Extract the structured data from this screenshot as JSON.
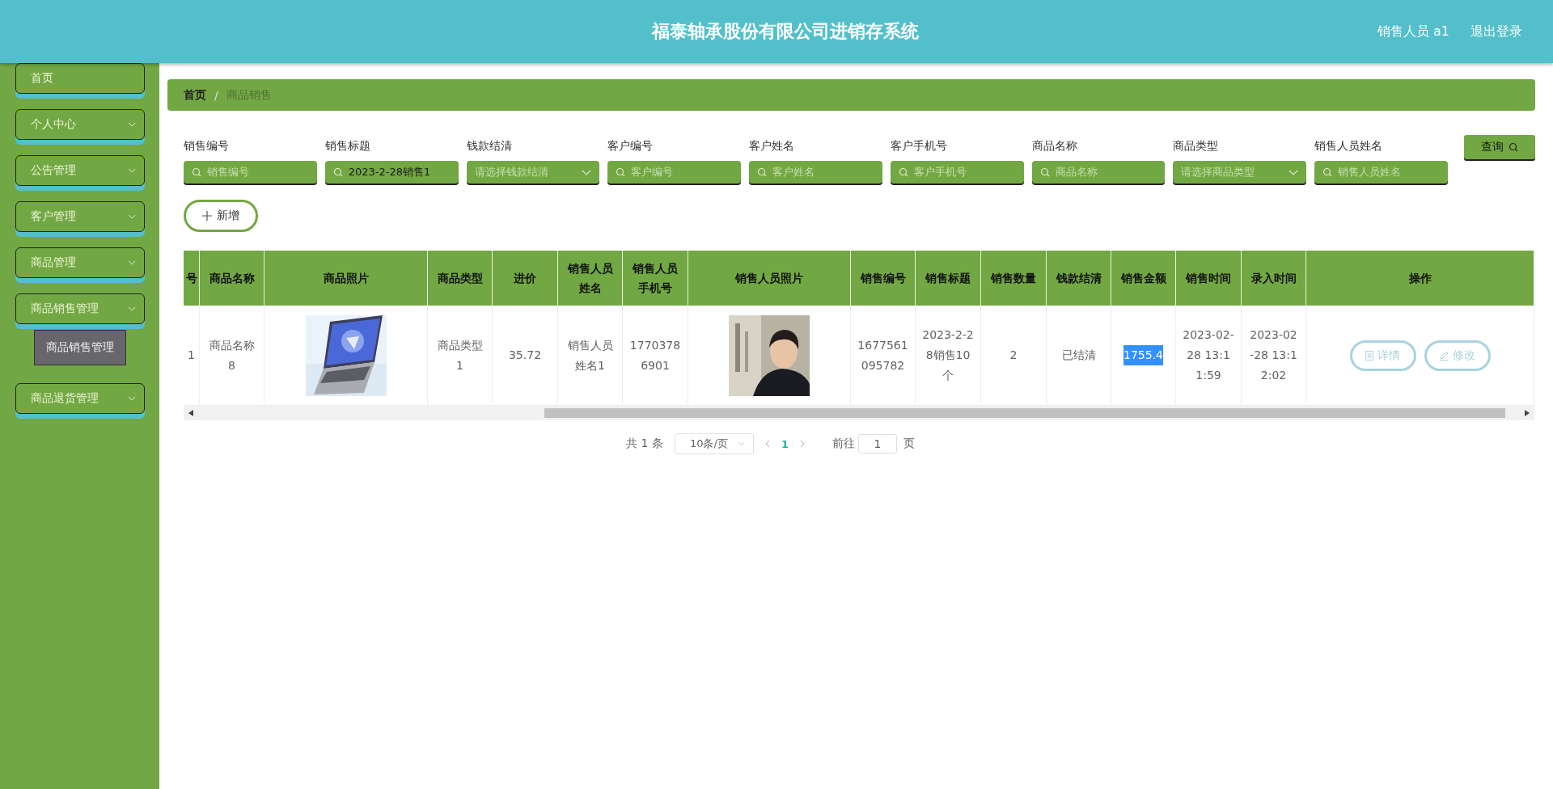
{
  "header": {
    "title": "福泰轴承股份有限公司进销存系统",
    "user": "销售人员 a1",
    "logout": "退出登录"
  },
  "sidebar": {
    "items": [
      {
        "label": "首页",
        "expandable": false
      },
      {
        "label": "个人中心",
        "expandable": true
      },
      {
        "label": "公告管理",
        "expandable": true
      },
      {
        "label": "客户管理",
        "expandable": true
      },
      {
        "label": "商品管理",
        "expandable": true
      },
      {
        "label": "商品销售管理",
        "expandable": true,
        "children": [
          {
            "label": "商品销售管理"
          }
        ]
      },
      {
        "label": "商品退货管理",
        "expandable": true
      }
    ]
  },
  "breadcrumb": [
    {
      "label": "首页",
      "current": false
    },
    {
      "label": "商品销售",
      "current": true
    }
  ],
  "breadcrumb_separator": "/",
  "filters": [
    {
      "label": "销售编号",
      "kind": "input",
      "placeholder": "销售编号"
    },
    {
      "label": "销售标题",
      "kind": "input",
      "value": "2023-2-28销售1"
    },
    {
      "label": "钱款结清",
      "kind": "select",
      "placeholder": "请选择钱款结清"
    },
    {
      "label": "客户编号",
      "kind": "input",
      "placeholder": "客户编号"
    },
    {
      "label": "客户姓名",
      "kind": "input",
      "placeholder": "客户姓名"
    },
    {
      "label": "客户手机号",
      "kind": "input",
      "placeholder": "客户手机号"
    },
    {
      "label": "商品名称",
      "kind": "input",
      "placeholder": "商品名称"
    },
    {
      "label": "商品类型",
      "kind": "select",
      "placeholder": "请选择商品类型"
    },
    {
      "label": "销售人员姓名",
      "kind": "input",
      "placeholder": "销售人员姓名"
    }
  ],
  "query_button": "查询",
  "add_button": "新增",
  "table": {
    "columns": [
      "号",
      "商品名称",
      "商品照片",
      "商品类型",
      "进价",
      "销售人员姓名",
      "销售人员手机号",
      "销售人员照片",
      "销售编号",
      "销售标题",
      "销售数量",
      "钱款结清",
      "销售金额",
      "销售时间",
      "录入时间",
      "操作"
    ],
    "rows": [
      [
        {
          "kind": "text",
          "text": "1",
          "highlighted": false
        },
        {
          "kind": "text",
          "text": "商品名称8",
          "highlighted": false
        },
        {
          "kind": "picture"
        },
        {
          "kind": "text",
          "text": "商品类型1",
          "highlighted": false
        },
        {
          "kind": "text",
          "text": "35.72",
          "highlighted": false
        },
        {
          "kind": "text",
          "text": "销售人员姓名1",
          "highlighted": false
        },
        {
          "kind": "text",
          "text": "17703786901",
          "highlighted": false
        },
        {
          "kind": "picture"
        },
        {
          "kind": "text",
          "text": "1677561095782",
          "highlighted": false
        },
        {
          "kind": "text",
          "text": "2023-2-28销售10个",
          "highlighted": false
        },
        {
          "kind": "text",
          "text": "2",
          "highlighted": false
        },
        {
          "kind": "text",
          "text": "已结清",
          "highlighted": false
        },
        {
          "kind": "text",
          "text": "1755.4",
          "highlighted": true
        },
        {
          "kind": "text",
          "text": "2023-02-28 13:11:59",
          "highlighted": false
        },
        {
          "kind": "text",
          "text": "2023-02-28 13:12:02",
          "highlighted": false
        },
        {
          "kind": "actions",
          "buttons": [
            {
              "label": "详情"
            },
            {
              "label": "修改"
            }
          ]
        }
      ]
    ]
  },
  "pagination": {
    "total": "共 1 条",
    "page_size": "10条/页",
    "pages": [
      {
        "label": "1",
        "selected": true
      }
    ],
    "jump_label": "前往",
    "jump_value": "1",
    "jump_suffix": "页"
  }
}
